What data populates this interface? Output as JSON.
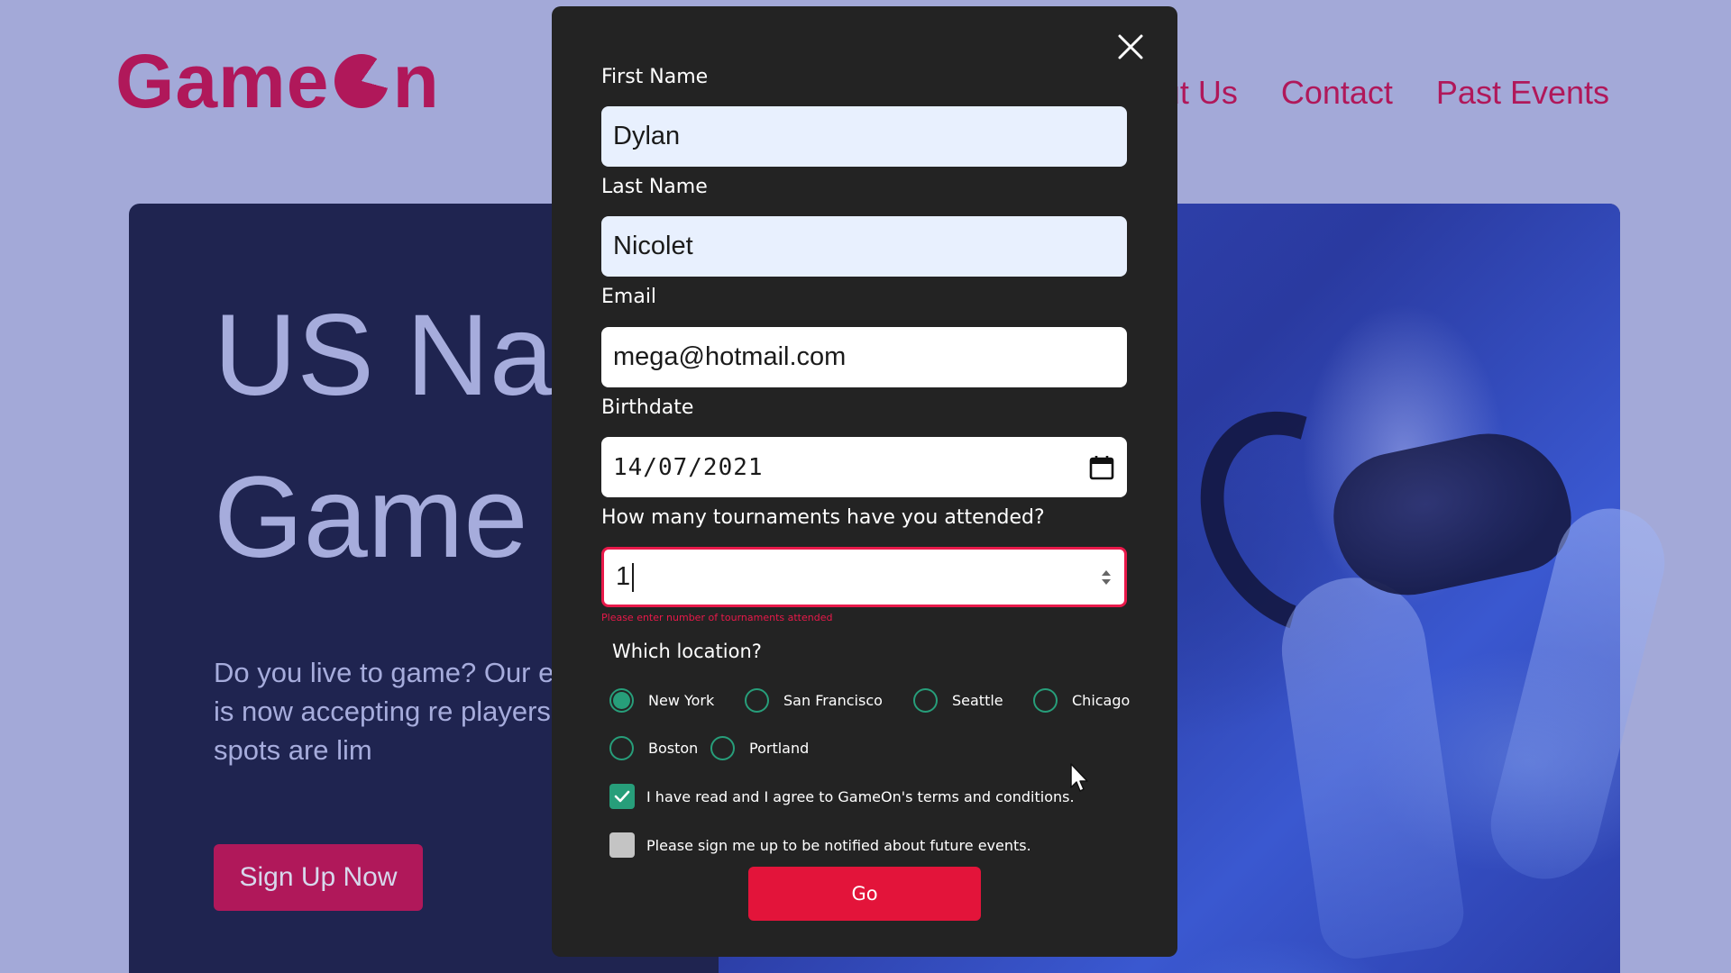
{
  "header": {
    "logo_text_left": "Game",
    "logo_text_right": "n",
    "nav": [
      "ut Us",
      "Contact",
      "Past Events"
    ]
  },
  "hero": {
    "title_line1": "US Na",
    "title_line2": "Game",
    "text": "Do you live to game? Our event is now accepting re players, but spots are lim",
    "signup_label": "Sign Up Now"
  },
  "form": {
    "first_name": {
      "label": "First Name",
      "value": "Dylan"
    },
    "last_name": {
      "label": "Last Name",
      "value": "Nicolet"
    },
    "email": {
      "label": "Email",
      "value": "mega@hotmail.com"
    },
    "birthdate": {
      "label": "Birthdate",
      "value": "14/07/2021"
    },
    "tournaments": {
      "label": "How many tournaments have you attended?",
      "value": "1",
      "error": "Please enter number of tournaments attended"
    },
    "location": {
      "label": "Which location?",
      "options": [
        "New York",
        "San Francisco",
        "Seattle",
        "Chicago",
        "Boston",
        "Portland"
      ],
      "selected": "New York"
    },
    "terms": {
      "label": "I have read and I agree to GameOn's terms and conditions.",
      "checked": true
    },
    "notify": {
      "label": "Please sign me up to be notified about future events.",
      "checked": false
    },
    "submit_label": "Go"
  },
  "colors": {
    "brand": "#b0185a",
    "accent_green": "#279e7a",
    "error_red": "#e8194a",
    "button_red": "#e3143a",
    "modal_bg": "#232323",
    "page_bg": "#a3a9d8"
  },
  "icons": {
    "close": "close-icon",
    "calendar": "calendar-icon",
    "check": "check-icon",
    "cursor": "mouse-cursor-icon"
  }
}
